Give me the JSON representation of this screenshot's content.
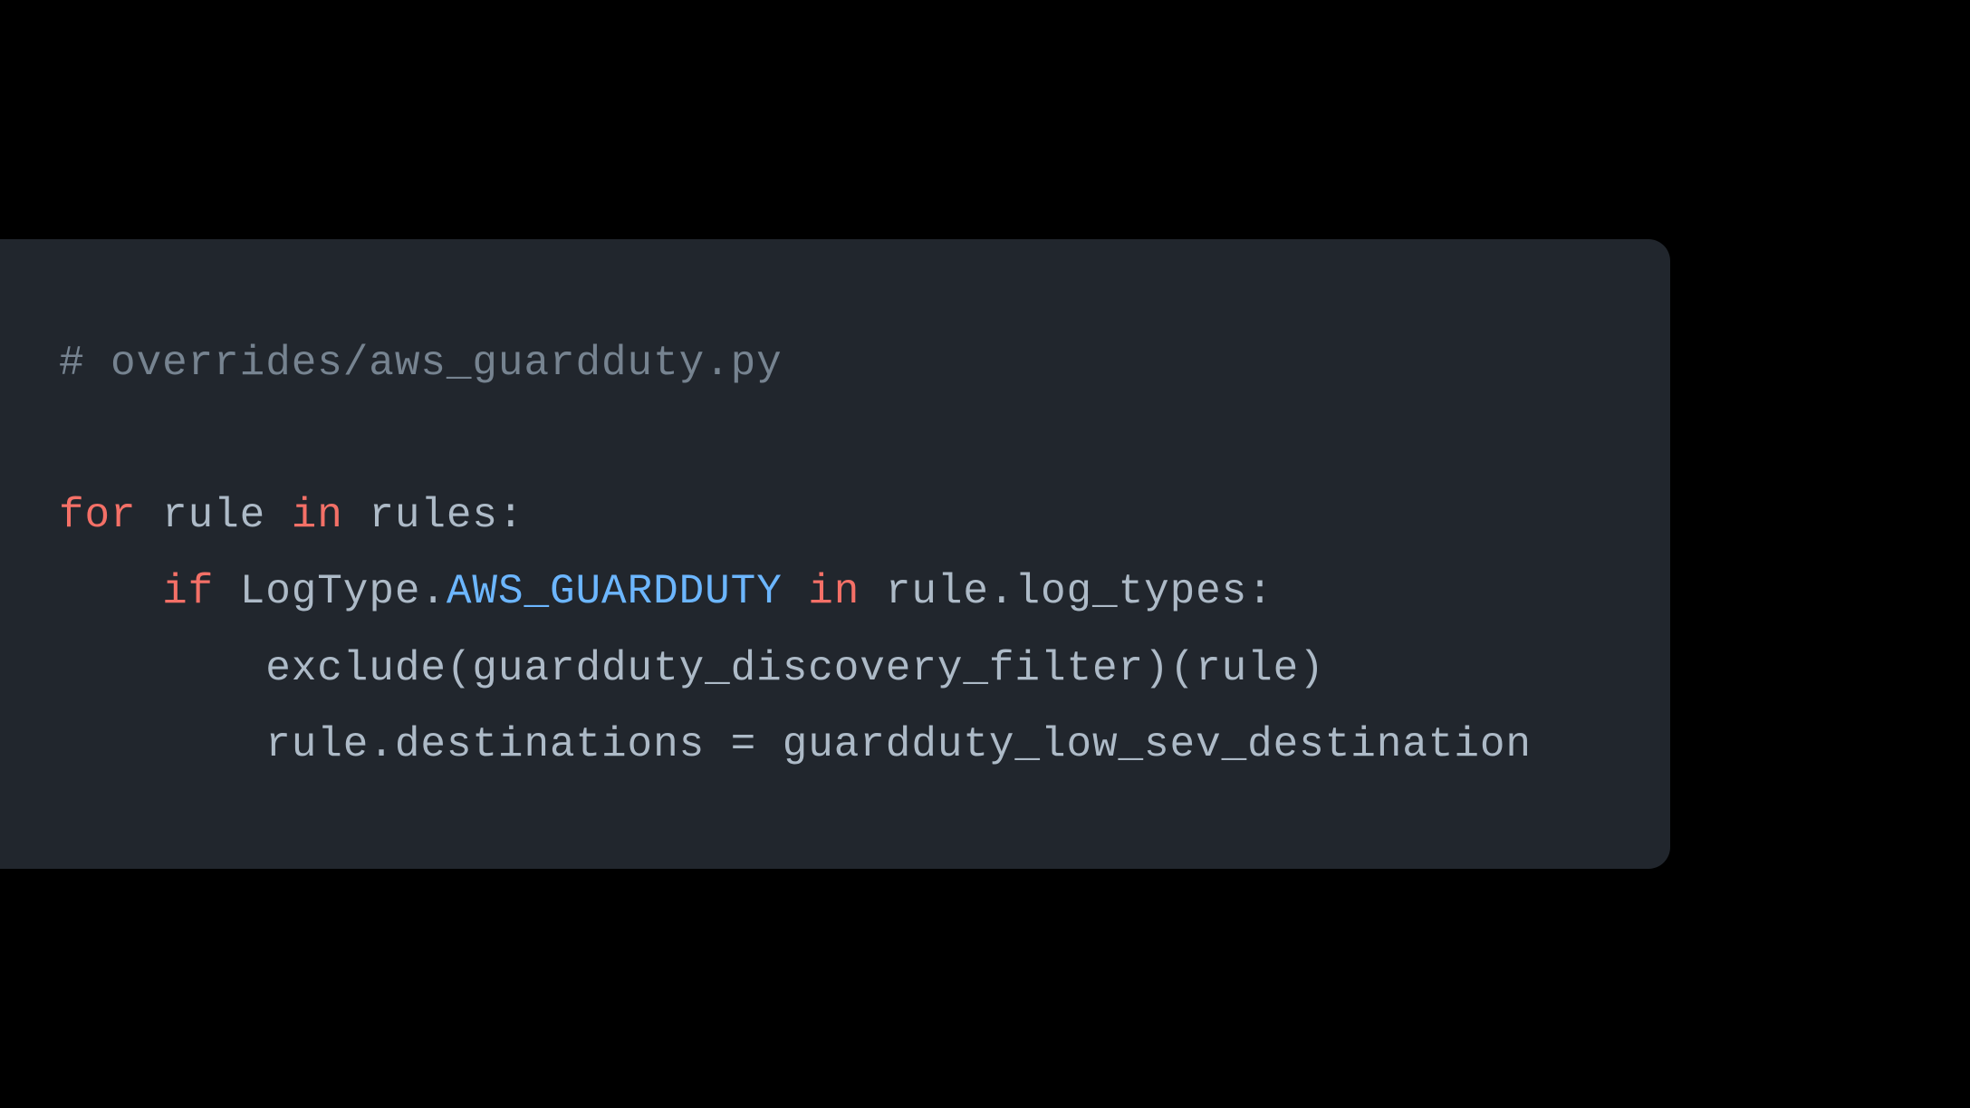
{
  "code": {
    "comment": "# overrides/aws_guardduty.py",
    "line1": {
      "for": "for",
      "rule": " rule ",
      "in": "in",
      "rules": " rules:"
    },
    "line2": {
      "indent": "    ",
      "if": "if",
      "logtype": " LogType.",
      "aws_guardduty": "AWS_GUARDDUTY",
      "space": " ",
      "in": "in",
      "rule_logtypes": " rule.log_types:"
    },
    "line3": {
      "indent": "        ",
      "content": "exclude(guardduty_discovery_filter)(rule)"
    },
    "line4": {
      "indent": "        ",
      "content": "rule.destinations = guardduty_low_sev_destination"
    }
  }
}
